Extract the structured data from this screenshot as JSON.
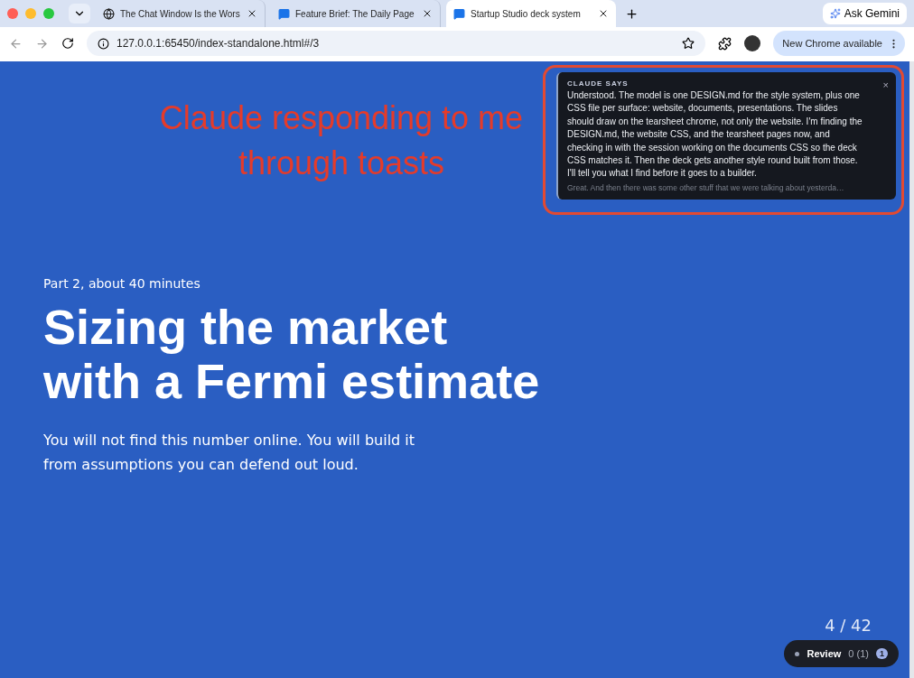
{
  "browser": {
    "tabs": [
      {
        "title": "The Chat Window Is the Wors",
        "kind": "globe",
        "selected": false
      },
      {
        "title": "Feature Brief: The Daily Page",
        "kind": "chat",
        "selected": false
      },
      {
        "title": "Startup Studio deck system",
        "kind": "chat",
        "selected": true
      }
    ],
    "ask_button": "Ask Gemini",
    "url": "127.0.0.1:65450/index-standalone.html#/3",
    "update_button": "New Chrome available"
  },
  "annotation": {
    "text": "Claude responding to me through toasts"
  },
  "toast": {
    "heading": "CLAUDE SAYS",
    "message": "Understood. The model is one DESIGN.md for the style system, plus one CSS file per surface: website, documents, presentations. The slides should draw on the tearsheet chrome, not only the website. I'm finding the DESIGN.md, the website CSS, and the tearsheet pages now, and checking in with the session working on the documents CSS so the deck CSS matches it. Then the deck gets another style round built from those. I'll tell you what I find before it goes to a builder.",
    "preview": "Great. And then there was some other stuff that we were talking about yesterda…",
    "close": "×"
  },
  "slide": {
    "eyebrow": "Part 2, about 40 minutes",
    "title": "Sizing the market with a Fermi estimate",
    "subtitle": "You will not find this number online. You will build it from assumptions you can defend out loud.",
    "counter": "4 / 42"
  },
  "review": {
    "label": "Review",
    "count": "0 (1)",
    "badge": "1"
  }
}
